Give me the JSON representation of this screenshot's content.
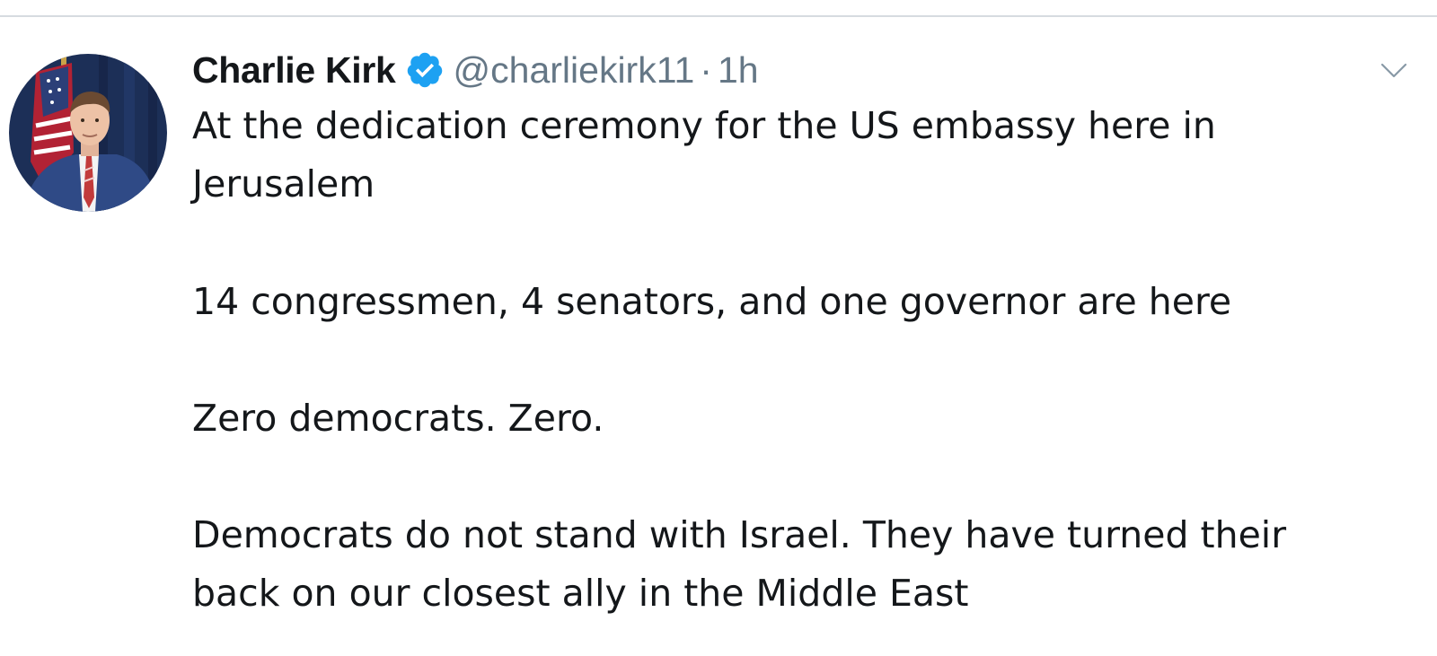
{
  "tweet": {
    "author": {
      "display_name": "Charlie Kirk",
      "handle": "@charliekirk11",
      "verified": true,
      "verified_icon": "verified-badge-icon",
      "avatar": "profile-avatar"
    },
    "separator": "·",
    "timestamp": "1h",
    "menu_icon": "chevron-down-icon",
    "paragraphs": [
      "At the dedication ceremony for the US embassy here in\nJerusalem",
      "14 congressmen, 4 senators, and one governor are here",
      "Zero democrats. Zero.",
      "Democrats do not stand with Israel. They have turned their\nback on our closest ally in the Middle East"
    ]
  },
  "colors": {
    "verified_blue": "#1da1f2",
    "secondary_text": "#657786",
    "primary_text": "#14171a",
    "divider": "#d6dbe0"
  }
}
